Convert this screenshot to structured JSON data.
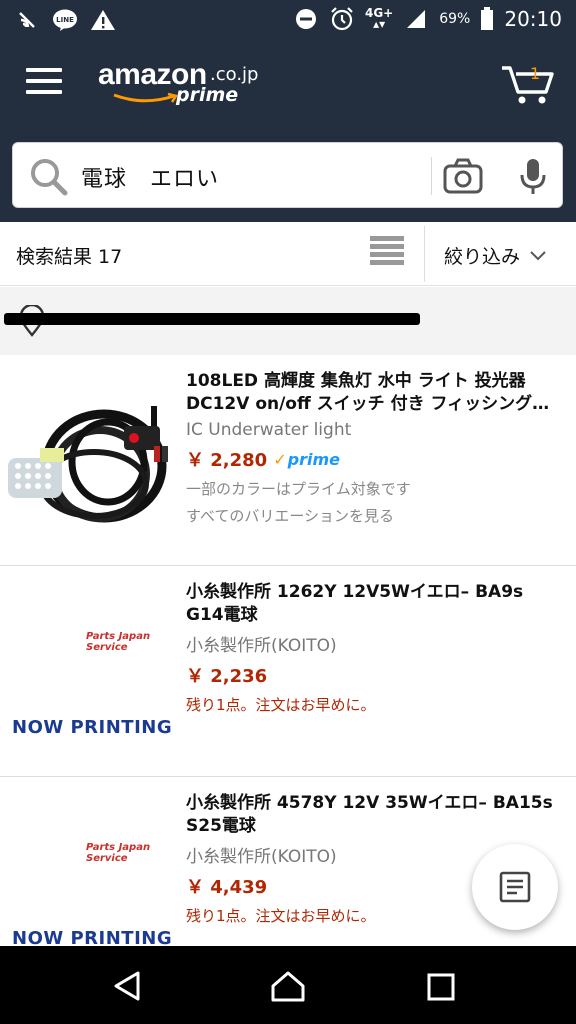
{
  "status_bar": {
    "network": "4G+",
    "battery": "69%",
    "time": "20:10",
    "icons_left": [
      "cast-icon",
      "line-icon",
      "warning-icon"
    ],
    "icons_right": [
      "dnd-icon",
      "alarm-icon",
      "signal-icon",
      "battery-icon"
    ]
  },
  "header": {
    "logo_main": "amazon",
    "logo_domain": ".co.jp",
    "logo_prime": "prime",
    "cart_count": "1",
    "search_query": "電球　エロい"
  },
  "results": {
    "count_label": "検索結果 17",
    "filter_label": "絞り込み"
  },
  "products": [
    {
      "title": "108LED 高輝度 集魚灯 水中 ライト 投光器 DC12V on/off スイッチ 付き フィッシング…",
      "brand": "IC Underwater light",
      "price": "￥ 2,280",
      "prime": "prime",
      "note1": "一部のカラーはプライム対象です",
      "note2": "すべてのバリエーションを見る"
    },
    {
      "title": "小糸製作所 1262Y 12V5Wイエロ– BA9s G14電球",
      "brand": "小糸製作所(KOITO)",
      "price": "￥ 2,236",
      "stock": "残り1点。注文はお早めに。",
      "thumb_brand": "Parts Japan Service",
      "thumb_text": "NOW PRINTING"
    },
    {
      "title": "小糸製作所 4578Y 12V 35Wイエロ– BA15s S25電球",
      "brand": "小糸製作所(KOITO)",
      "price": "￥ 4,439",
      "stock": "残り1点。注文はお早めに。",
      "thumb_brand": "Parts Japan Service",
      "thumb_text": "NOW PRINTING"
    }
  ],
  "colors": {
    "header_bg": "#232f3e",
    "price": "#b12704",
    "prime_blue": "#1a98ff",
    "accent_orange": "#ff9900"
  }
}
